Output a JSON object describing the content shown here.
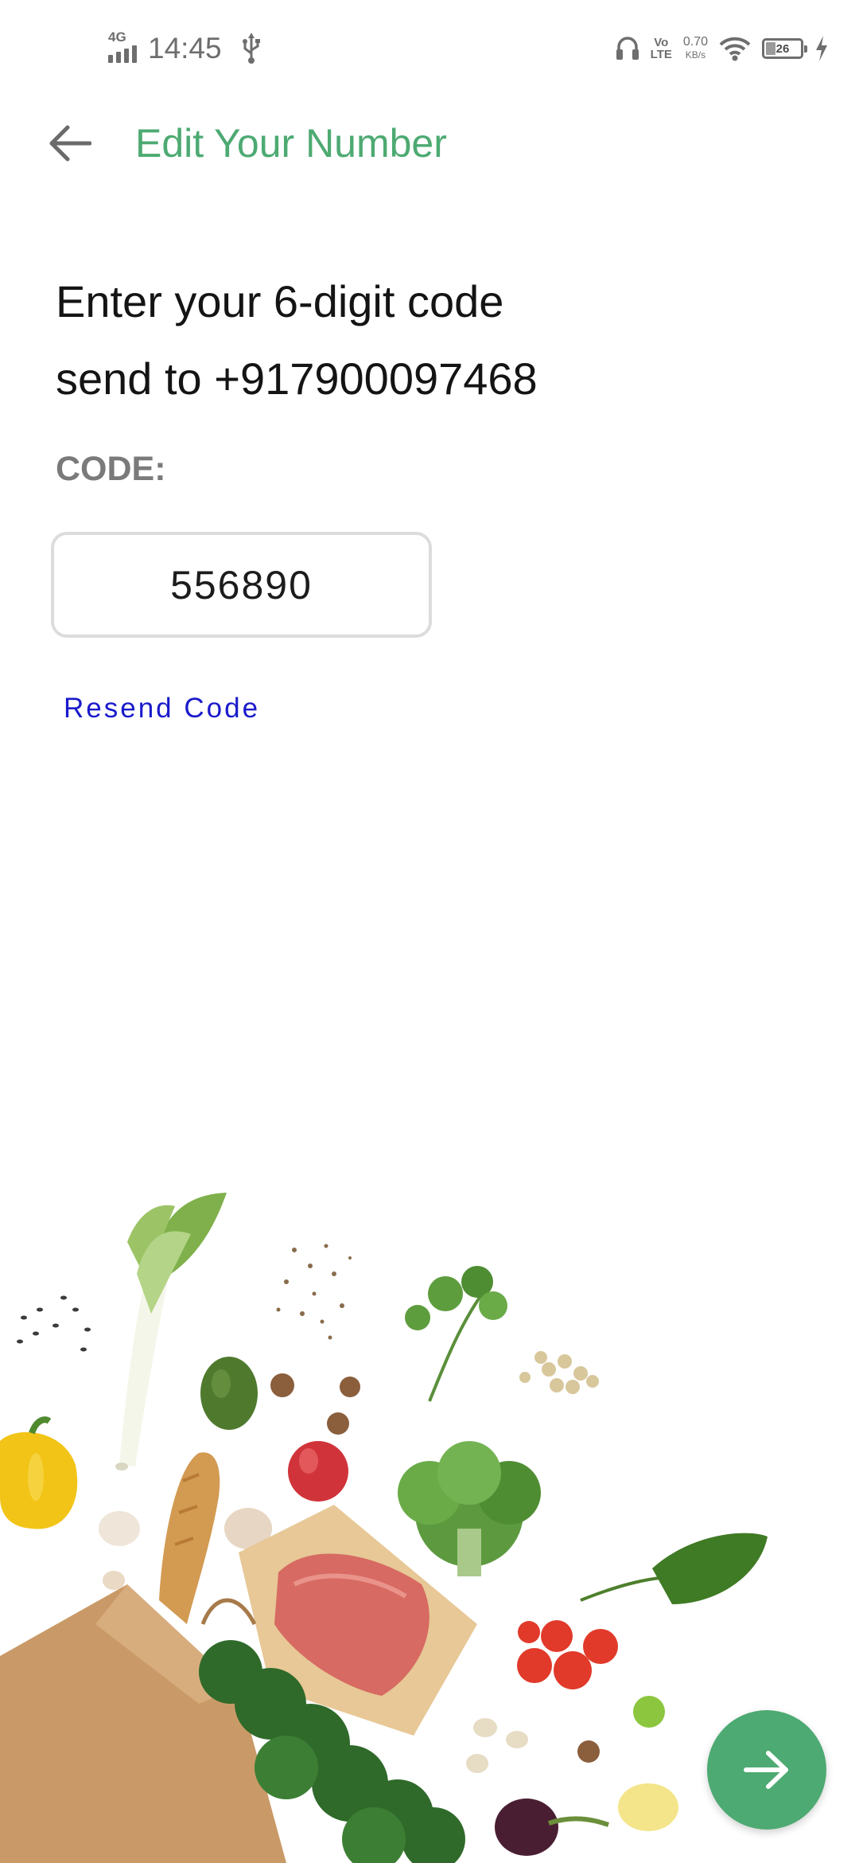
{
  "status_bar": {
    "network": "4G",
    "time": "14:45",
    "volte_top": "Vo",
    "volte_bottom": "LTE",
    "speed_value": "0.70",
    "speed_unit": "KB/s",
    "battery_level": "26",
    "battery_fraction": 0.26
  },
  "app_bar": {
    "title": "Edit Your Number",
    "back_icon": "arrow-left-icon",
    "title_color": "#4daa72"
  },
  "verification": {
    "instruction_line1": "Enter your 6-digit code",
    "instruction_line2": "send to +917900097468",
    "code_label": "CODE:",
    "code_value": "556890",
    "resend_label": "Resend Code"
  },
  "fab": {
    "icon": "arrow-right-icon",
    "color": "#4daa72"
  },
  "colors": {
    "accent": "#4daa72",
    "link": "#1a1acc"
  }
}
